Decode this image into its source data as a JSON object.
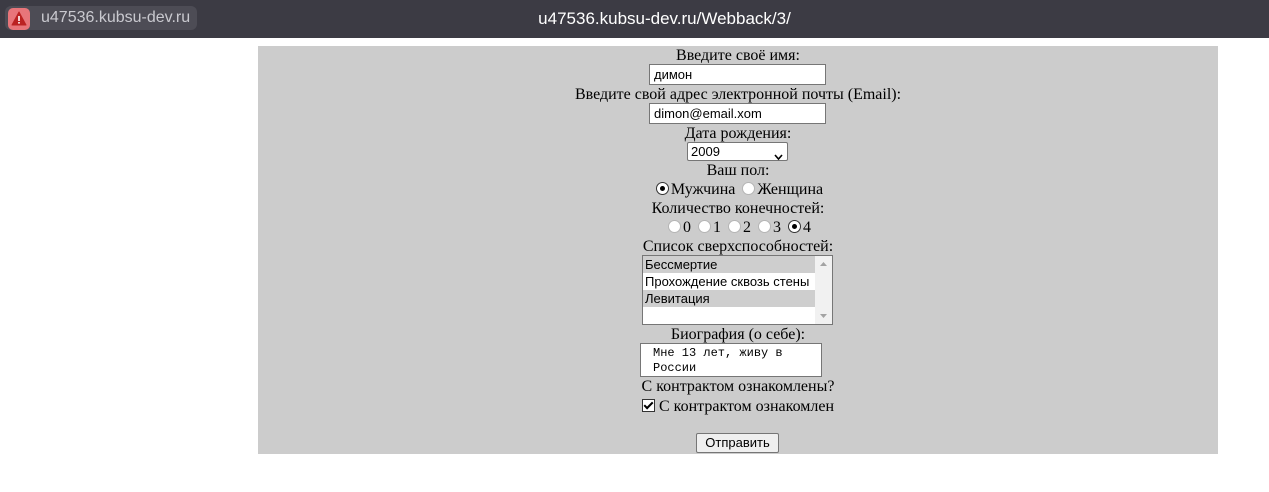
{
  "browser": {
    "site_label": "u47536.kubsu-dev.ru",
    "url": "u47536.kubsu-dev.ru/Webback/3/",
    "warning_icon": "warning-triangle-icon"
  },
  "form": {
    "name_label": "Введите своё имя:",
    "name_value": "димон",
    "email_label": "Введите свой адрес электронной почты (Email):",
    "email_value": "dimon@email.xom",
    "birth_label": "Дата рождения:",
    "birth_year": "2009",
    "gender_label": "Ваш пол:",
    "gender_options": [
      "Мужчина",
      "Женщина"
    ],
    "gender_selected": "Мужчина",
    "limbs_label": "Количество конечностей:",
    "limbs_options": [
      "0",
      "1",
      "2",
      "3",
      "4"
    ],
    "limbs_selected": "4",
    "powers_label": "Список сверхспособностей:",
    "powers": [
      {
        "label": "Бессмертие",
        "selected": true
      },
      {
        "label": "Прохождение сквозь стены",
        "selected": false
      },
      {
        "label": "Левитация",
        "selected": true
      }
    ],
    "bio_label": "Биография (о себе):",
    "bio_value": "Мне 13 лет, живу в России",
    "contract_label": "С контрактом ознакомлены?",
    "contract_checkbox_label": "С контрактом ознакомлен",
    "contract_checked": true,
    "submit_label": "Отправить"
  },
  "colors": {
    "titlebar": "#3c3b44",
    "panel": "#cccccc",
    "warning": "#e8757a"
  }
}
